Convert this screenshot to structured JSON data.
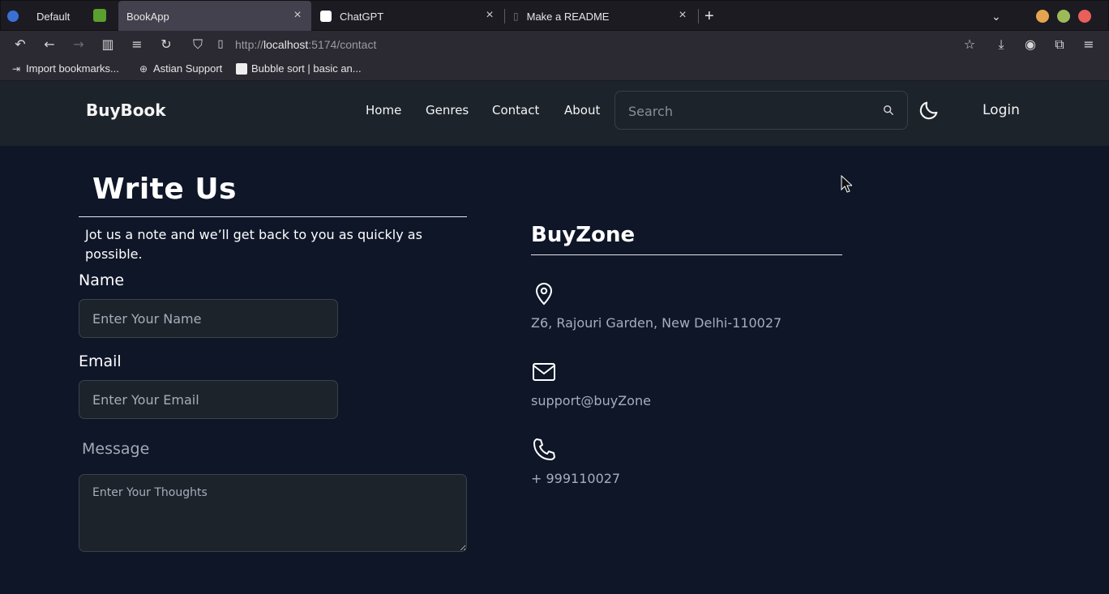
{
  "browser": {
    "tabs": [
      {
        "title": "Default",
        "active": false
      },
      {
        "title": "BookApp",
        "active": true
      },
      {
        "title": "ChatGPT",
        "active": false
      },
      {
        "title": "Make a README",
        "active": false
      }
    ],
    "new_tab_symbol": "+",
    "url_prefix": "http://",
    "url_host": "localhost",
    "url_rest": ":5174/contact",
    "bookmarks": [
      {
        "label": "Import bookmarks...",
        "icon": "import-icon"
      },
      {
        "label": "Astian Support",
        "icon": "globe-icon"
      },
      {
        "label": "Bubble sort | basic an...",
        "icon": "page-icon"
      }
    ],
    "window_buttons": {
      "minimize": "#e5a54f",
      "maximize": "#9bbb59",
      "close": "#e95f5b"
    }
  },
  "site": {
    "brand": "BuyBook",
    "nav": [
      "Home",
      "Genres",
      "Contact",
      "About"
    ],
    "search_placeholder": "Search",
    "login": "Login",
    "theme_icon": "moon-icon"
  },
  "form": {
    "heading": "Write Us",
    "lead": "Jot us a note and we’ll get back to you as quickly as possible.",
    "name_label": "Name",
    "name_placeholder": "Enter Your Name",
    "email_label": "Email",
    "email_placeholder": "Enter Your Email",
    "message_label": "Message",
    "message_placeholder": "Enter Your Thoughts"
  },
  "contact": {
    "heading": "BuyZone",
    "address": "Z6, Rajouri Garden, New Delhi-110027",
    "email": "support@buyZone",
    "phone": "+ 999110027"
  },
  "colors": {
    "page_bg": "#0e1628",
    "header_bg": "#1d232a",
    "input_bg": "#1d232a",
    "muted_text": "#a6adbb"
  }
}
